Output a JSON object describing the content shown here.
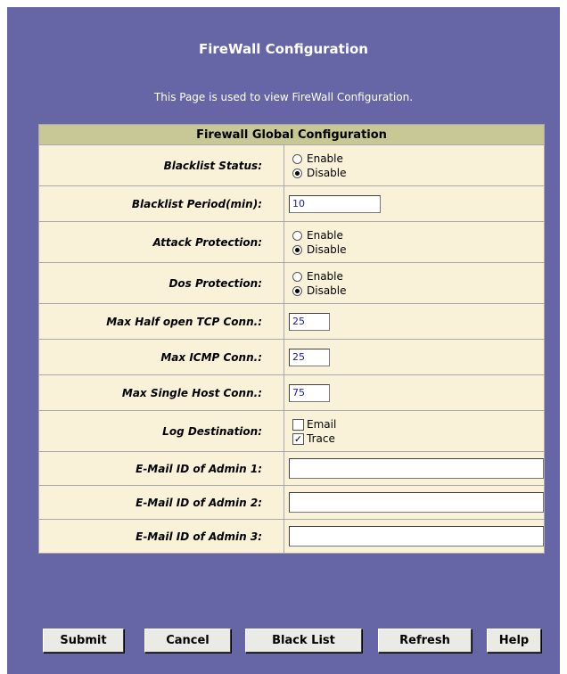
{
  "page": {
    "title": "FireWall Configuration",
    "description": "This Page is used to view FireWall Configuration."
  },
  "table": {
    "header": "Firewall Global Configuration",
    "blacklist_status": {
      "label": "Blacklist Status:",
      "options": [
        "Enable",
        "Disable"
      ],
      "selected": "Disable"
    },
    "blacklist_period": {
      "label": "Blacklist Period(min):",
      "value": "10"
    },
    "attack_protection": {
      "label": "Attack Protection:",
      "options": [
        "Enable",
        "Disable"
      ],
      "selected": "Disable"
    },
    "dos_protection": {
      "label": "Dos Protection:",
      "options": [
        "Enable",
        "Disable"
      ],
      "selected": "Disable"
    },
    "max_half_open_tcp": {
      "label": "Max Half open TCP Conn.:",
      "value": "25"
    },
    "max_icmp": {
      "label": "Max ICMP Conn.:",
      "value": "25"
    },
    "max_single_host": {
      "label": "Max Single Host Conn.:",
      "value": "75"
    },
    "log_destination": {
      "label": "Log Destination:",
      "options": [
        {
          "label": "Email",
          "checked": false
        },
        {
          "label": "Trace",
          "checked": true
        }
      ]
    },
    "admin1": {
      "label": "E-Mail ID of Admin 1:",
      "value": ""
    },
    "admin2": {
      "label": "E-Mail ID of Admin 2:",
      "value": ""
    },
    "admin3": {
      "label": "E-Mail ID of Admin 3:",
      "value": ""
    }
  },
  "buttons": {
    "submit": "Submit",
    "cancel": "Cancel",
    "black_list": "Black List",
    "refresh": "Refresh",
    "help": "Help"
  },
  "colors": {
    "background": "#6666a6",
    "table_header": "#c8c896",
    "table_body": "#faf2d8"
  }
}
